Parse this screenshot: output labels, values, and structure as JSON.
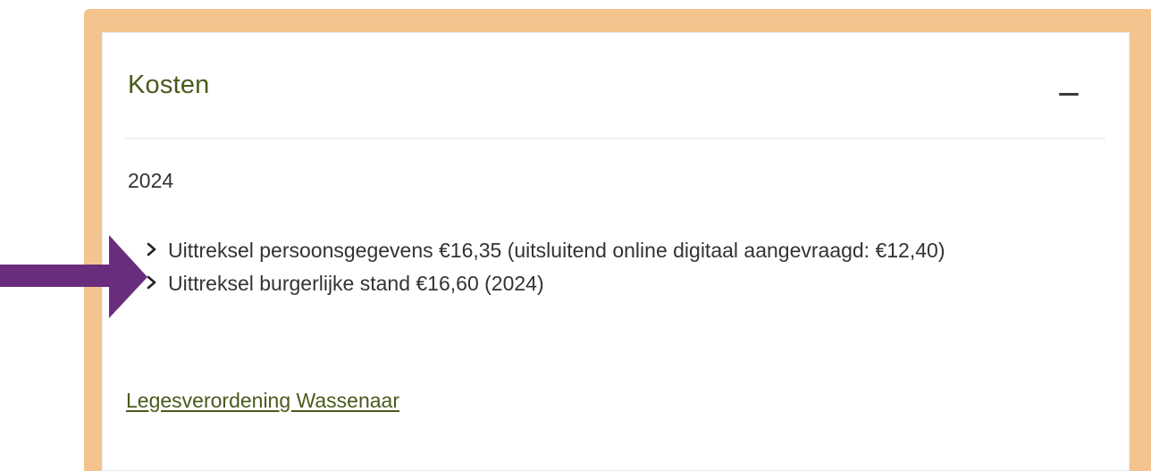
{
  "panel": {
    "title": "Kosten",
    "toggle_icon": "minus-icon",
    "year": "2024",
    "items": [
      {
        "label": "Uittreksel persoonsgegevens €16,35 (uitsluitend online digitaal aangevraagd: €12,40)"
      },
      {
        "label": "Uittreksel burgerlijke stand €16,60 (2024)"
      }
    ],
    "link_label": "Legesverordening Wassenaar"
  },
  "colors": {
    "frame": "#f3c48e",
    "title": "#4a5a1c",
    "arrow": "#6a2c7c",
    "text": "#333333"
  },
  "annotation": {
    "icon": "arrow-right-icon"
  }
}
